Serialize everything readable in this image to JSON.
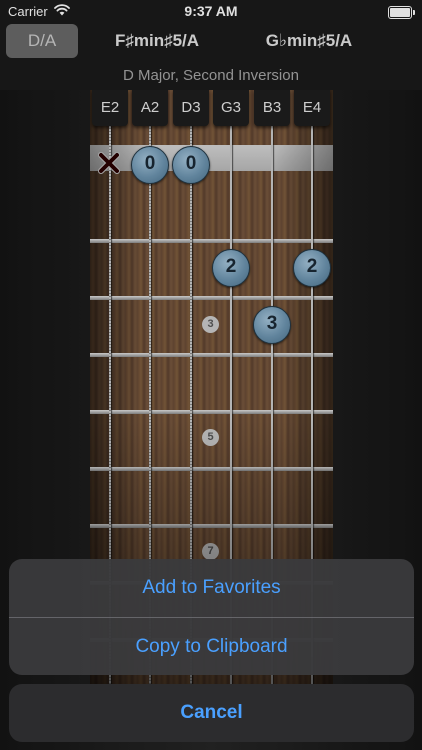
{
  "status_bar": {
    "carrier": "Carrier",
    "time": "9:37 AM"
  },
  "tabs": [
    {
      "label": "D/A",
      "selected": true
    },
    {
      "label": "F♯min♯5/A",
      "selected": false
    },
    {
      "label": "G♭min♯5/A",
      "selected": false
    }
  ],
  "subtitle": "D Major, Second Inversion",
  "strings": [
    "E2",
    "A2",
    "D3",
    "G3",
    "B3",
    "E4"
  ],
  "fret_markers": [
    "3",
    "5",
    "7"
  ],
  "finger_dots": [
    {
      "string": 1,
      "fret": 0,
      "label": "0"
    },
    {
      "string": 2,
      "fret": 0,
      "label": "0"
    },
    {
      "string": 3,
      "fret": 2,
      "label": "2"
    },
    {
      "string": 5,
      "fret": 2,
      "label": "2"
    },
    {
      "string": 4,
      "fret": 3,
      "label": "3"
    }
  ],
  "muted_string": 0,
  "action_sheet": {
    "add_favorites": "Add to Favorites",
    "copy_clipboard": "Copy to Clipboard",
    "cancel": "Cancel"
  },
  "colors": {
    "accent": "#4aa0ff",
    "dot": "#6f97b3"
  }
}
